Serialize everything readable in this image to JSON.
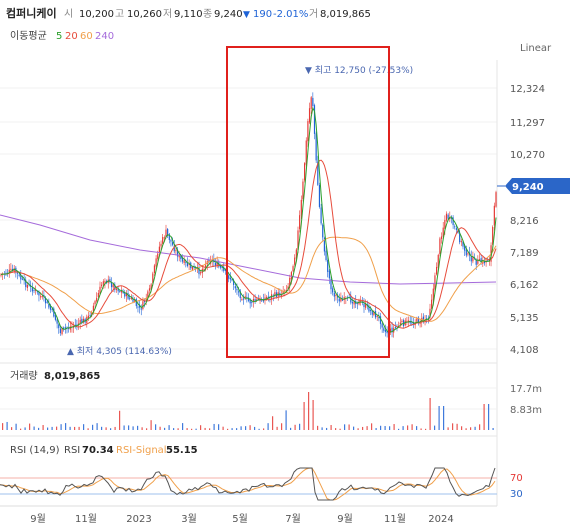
{
  "header": {
    "stock_name": "컴퍼니케이",
    "open_label": "시",
    "open_value": "10,200",
    "high_label": "고",
    "high_value": "10,260",
    "low_label": "저",
    "low_value": "9,110",
    "close_label": "종",
    "close_value": "9,240",
    "change_arrow": "▼",
    "change_value": "190",
    "change_pct": "-2.01%",
    "volume_label": "거",
    "volume_value": "8,019,865"
  },
  "ma_legend": {
    "label": "이동평균",
    "items": [
      {
        "label": "5",
        "color": "#2ca02c"
      },
      {
        "label": "20",
        "color": "#e74c3c"
      },
      {
        "label": "60",
        "color": "#f0a04b"
      },
      {
        "label": "240",
        "color": "#a56bdb"
      }
    ]
  },
  "scale_mode": "Linear",
  "price_axis": {
    "ticks": [
      "12,324",
      "11,297",
      "10,270",
      "8,216",
      "7,189",
      "6,162",
      "5,135",
      "4,108"
    ],
    "current_price": "9,240",
    "current_price_color": "#2b66c8"
  },
  "annotations": {
    "high": "▼ 최고 12,750 (-27.53%)",
    "low": "▲ 최저 4,305 (114.63%)"
  },
  "volume_panel": {
    "label": "거래량",
    "value": "8,019,865",
    "ticks": [
      "17.7m",
      "8.83m"
    ]
  },
  "rsi_panel": {
    "label": "RSI (14,9)",
    "rsi_label": "RSI",
    "rsi_value": "70.34",
    "signal_label": "RSI-Signal",
    "signal_value": "55.15",
    "ticks": [
      "70",
      "30"
    ],
    "rsi_color": "#555555",
    "signal_color": "#f0a04b"
  },
  "x_axis": {
    "labels": [
      "9월",
      "11월",
      "2023",
      "3월",
      "5월",
      "7월",
      "9월",
      "11월",
      "2024"
    ]
  },
  "colors": {
    "up": "#e53935",
    "down": "#1e63d6",
    "highlight_box": "#e0201c"
  }
}
